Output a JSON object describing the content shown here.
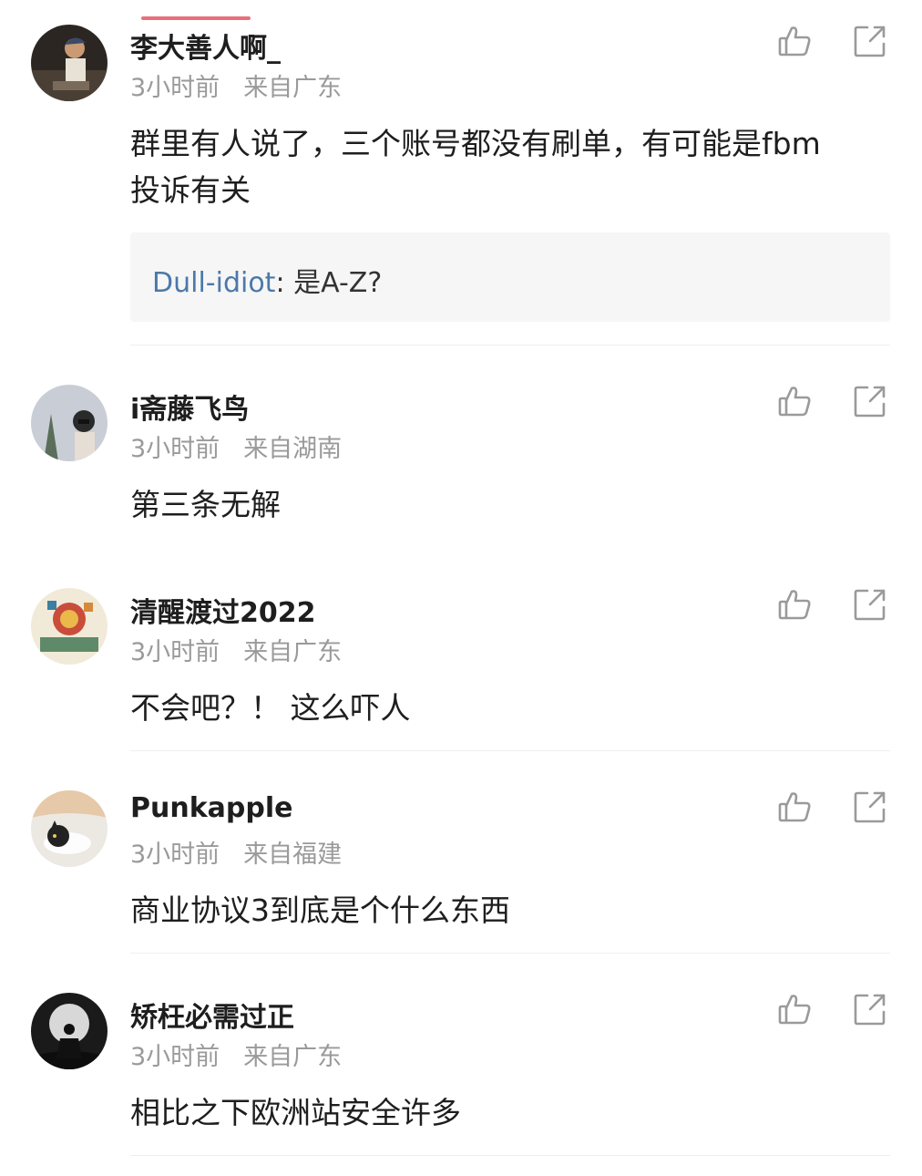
{
  "comments": [
    {
      "username": "李大善人啊_",
      "time": "3小时前",
      "location": "来自广东",
      "content": "群里有人说了，三个账号都没有刷单，有可能是fbm 投诉有关",
      "reply": {
        "user": "Dull-idiot",
        "separator": ":",
        "text": " 是A-Z?"
      }
    },
    {
      "username": "i斋藤飞鸟",
      "time": "3小时前",
      "location": "来自湖南",
      "content": "第三条无解"
    },
    {
      "username": "清醒渡过2022",
      "time": "3小时前",
      "location": "来自广东",
      "content": "不会吧？！ 这么吓人"
    },
    {
      "username": "Punkapple",
      "time": "3小时前",
      "location": "来自福建",
      "content": "商业协议3到底是个什么东西"
    },
    {
      "username": "矫枉必需过正",
      "time": "3小时前",
      "location": "来自广东",
      "content": "相比之下欧洲站安全许多"
    }
  ],
  "colors": {
    "accent": "#e8707a",
    "reply_user": "#4b79a8",
    "meta_text": "#9a9a9a",
    "icon": "#9a9a9a"
  },
  "icons": {
    "like": "thumbs-up-icon",
    "share": "share-icon"
  }
}
